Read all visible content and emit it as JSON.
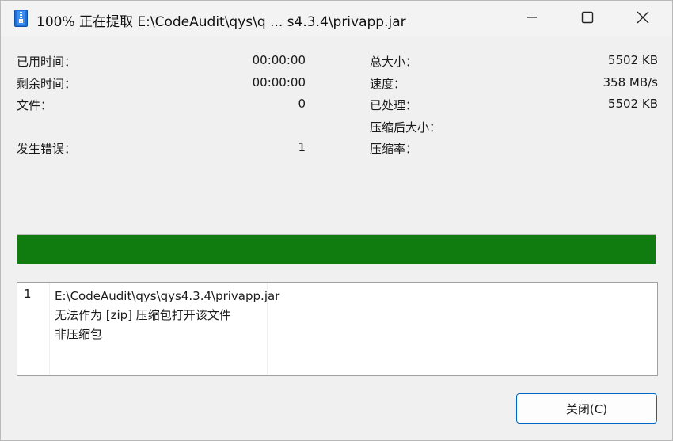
{
  "window": {
    "title": "100% 正在提取 E:\\CodeAudit\\qys\\q ... s4.3.4\\privapp.jar"
  },
  "stats_left": [
    {
      "label": "已用时间：",
      "value": "00:00:00"
    },
    {
      "label": "剩余时间：",
      "value": "00:00:00"
    },
    {
      "label": "文件：",
      "value": "0"
    },
    {
      "label": "发生错误：",
      "value": "1"
    }
  ],
  "stats_right": [
    {
      "label": "总大小：",
      "value": "5502 KB"
    },
    {
      "label": "速度：",
      "value": "358 MB/s"
    },
    {
      "label": "已处理：",
      "value": "5502 KB"
    },
    {
      "label": "压缩后大小：",
      "value": ""
    },
    {
      "label": "压缩率：",
      "value": ""
    }
  ],
  "progress": {
    "percent": 100,
    "color": "#107c10"
  },
  "messages": [
    {
      "index": "1",
      "lines": [
        "E:\\CodeAudit\\qys\\qys4.3.4\\privapp.jar",
        "无法作为 [zip] 压缩包打开该文件",
        "非压缩包"
      ]
    }
  ],
  "buttons": {
    "close_label": "关闭(C)"
  },
  "icons": {
    "app": "archive-icon",
    "minimize": "minimize-icon",
    "maximize": "maximize-icon",
    "close": "close-icon"
  }
}
